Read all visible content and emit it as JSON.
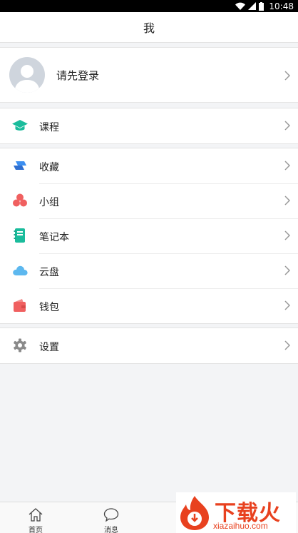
{
  "status_bar": {
    "time": "10:48"
  },
  "header": {
    "title": "我"
  },
  "profile": {
    "label": "请先登录"
  },
  "menu_groups": [
    [
      {
        "label": "课程",
        "icon": "graduation-cap-icon"
      }
    ],
    [
      {
        "label": "收藏",
        "icon": "bookmark-icon"
      },
      {
        "label": "小组",
        "icon": "group-icon"
      },
      {
        "label": "笔记本",
        "icon": "notebook-icon"
      },
      {
        "label": "云盘",
        "icon": "cloud-icon"
      },
      {
        "label": "钱包",
        "icon": "wallet-icon"
      }
    ],
    [
      {
        "label": "设置",
        "icon": "gear-icon"
      }
    ]
  ],
  "tab_bar": {
    "tabs": [
      {
        "label": "首页",
        "icon": "home-icon"
      },
      {
        "label": "消息",
        "icon": "message-icon"
      }
    ]
  },
  "watermark": {
    "title": "下载火",
    "url": "xiazaihuo.com"
  },
  "colors": {
    "accent_green": "#1abc9c",
    "blue": "#3b8ef0",
    "red": "#f06060",
    "cloud": "#5db8ef"
  }
}
